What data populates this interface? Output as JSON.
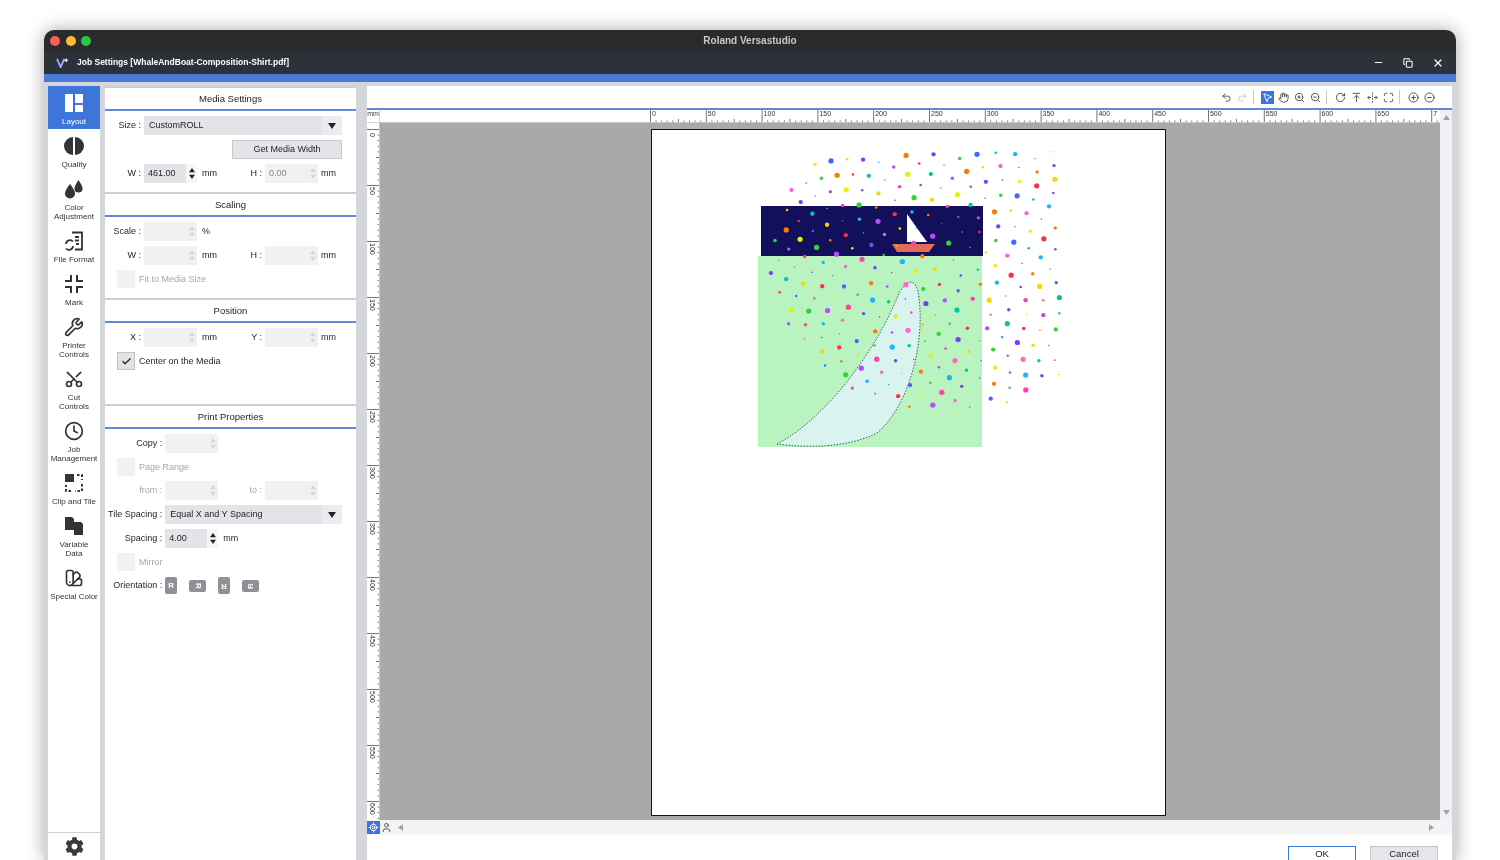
{
  "window": {
    "title": "Roland Versastudio"
  },
  "dialog": {
    "title": "Job Settings [WhaleAndBoat-Composition-Shirt.pdf]"
  },
  "sidebar": {
    "items": [
      {
        "label": "Layout",
        "selected": true
      },
      {
        "label": "Quality",
        "selected": false
      },
      {
        "label": "Color\nAdjustment",
        "selected": false
      },
      {
        "label": "File Format",
        "selected": false
      },
      {
        "label": "Mark",
        "selected": false
      },
      {
        "label": "Printer\nControls",
        "selected": false
      },
      {
        "label": "Cut\nControls",
        "selected": false
      },
      {
        "label": "Job\nManagement",
        "selected": false
      },
      {
        "label": "Clip and Tile",
        "selected": false
      },
      {
        "label": "Variable\nData",
        "selected": false
      },
      {
        "label": "Special Color",
        "selected": false
      }
    ]
  },
  "panel": {
    "sections": [
      {
        "title": "Media Settings",
        "rows": [
          {
            "kind": "dropdown",
            "label": "Size :",
            "value": "CustomROLL"
          },
          {
            "kind": "button",
            "label": "Get Media Width"
          },
          {
            "kind": "fields",
            "disabled": false,
            "fields": [
              {
                "label": "W :",
                "value": "461.00",
                "unit": "mm",
                "disabled": false
              },
              {
                "label": "H :",
                "value": "0.00",
                "unit": "mm",
                "disabled": true
              }
            ]
          }
        ]
      },
      {
        "title": "Scaling",
        "rows": [
          {
            "kind": "fields",
            "disabled": false,
            "fields": [
              {
                "label": "Scale :",
                "unit": "%",
                "disabled": true
              }
            ]
          },
          {
            "kind": "fields",
            "disabled": false,
            "fields": [
              {
                "label": "W :",
                "unit": "mm",
                "disabled": true
              },
              {
                "label": "H :",
                "unit": "mm",
                "disabled": true
              }
            ]
          },
          {
            "kind": "checkbox",
            "label": "Fit to Media Size",
            "checked": false,
            "disabled": true
          }
        ]
      },
      {
        "title": "Position",
        "rows": [
          {
            "kind": "fields",
            "disabled": false,
            "fields": [
              {
                "label": "X :",
                "unit": "mm",
                "disabled": true
              },
              {
                "label": "Y :",
                "unit": "mm",
                "disabled": true
              }
            ]
          },
          {
            "kind": "checkbox",
            "label": "Center on the Media",
            "checked": true,
            "disabled": false
          }
        ]
      },
      {
        "title": "Print Properties",
        "rows": [
          {
            "kind": "fields",
            "disabled": false,
            "fields": [
              {
                "label": "Copy :",
                "disabled": true
              }
            ]
          },
          {
            "kind": "checkbox",
            "label": "Page Range",
            "checked": false,
            "disabled": true
          },
          {
            "kind": "fields",
            "disabled": true,
            "fields": [
              {
                "label": "from :",
                "disabled": true
              },
              {
                "label": "to :",
                "disabled": true
              }
            ]
          },
          {
            "kind": "dropdown",
            "label": "Tile Spacing :",
            "value": "Equal X and Y Spacing"
          },
          {
            "kind": "fields",
            "disabled": false,
            "fields": [
              {
                "label": "Spacing :",
                "value": "4.00",
                "unit": "mm",
                "disabled": false
              }
            ]
          },
          {
            "kind": "checkbox",
            "label": "Mirror",
            "checked": false,
            "disabled": true
          },
          {
            "kind": "orientation",
            "label": "Orientation :",
            "buttons": [
              {
                "glyph": "R",
                "kind": "up",
                "disabled": true
              },
              {
                "glyph": "R",
                "kind": "right",
                "disabled": true
              },
              {
                "glyph": "R",
                "kind": "down",
                "disabled": true
              },
              {
                "glyph": "R",
                "kind": "left",
                "disabled": true
              }
            ]
          }
        ]
      }
    ]
  },
  "toolbar": {
    "groups": [
      [
        {
          "kind": "undo",
          "selected": false,
          "disabled": false
        },
        {
          "kind": "redo",
          "selected": false,
          "disabled": true
        }
      ],
      [
        {
          "kind": "select",
          "selected": true,
          "disabled": false
        },
        {
          "kind": "hand",
          "selected": false,
          "disabled": false
        },
        {
          "kind": "zoom-in",
          "selected": false,
          "disabled": false
        },
        {
          "kind": "zoom-out",
          "selected": false,
          "disabled": false
        }
      ],
      [
        {
          "kind": "rotate",
          "selected": false,
          "disabled": false
        },
        {
          "kind": "align-top",
          "selected": false,
          "disabled": false
        },
        {
          "kind": "fit-width",
          "selected": false,
          "disabled": false
        },
        {
          "kind": "fit-page",
          "selected": false,
          "disabled": false
        }
      ],
      [
        {
          "kind": "zoom-plus",
          "selected": false,
          "disabled": false
        },
        {
          "kind": "zoom-minus",
          "selected": false,
          "disabled": false
        }
      ]
    ]
  },
  "ruler": {
    "unit": "mm",
    "x_labels": [
      "0",
      "50",
      "100",
      "150",
      "200",
      "250",
      "300",
      "350",
      "400",
      "450",
      "500",
      "550",
      "600",
      "650",
      "7"
    ],
    "y_labels": [
      "0",
      "50",
      "100",
      "150",
      "200",
      "250",
      "300",
      "350",
      "400",
      "450",
      "500",
      "550",
      "600"
    ]
  },
  "view_tools": [
    {
      "kind": "crosshair",
      "selected": true
    },
    {
      "kind": "person",
      "selected": false
    }
  ],
  "buttons": [
    {
      "label": "OK",
      "default": true
    },
    {
      "label": "Cancel",
      "default": false
    }
  ]
}
